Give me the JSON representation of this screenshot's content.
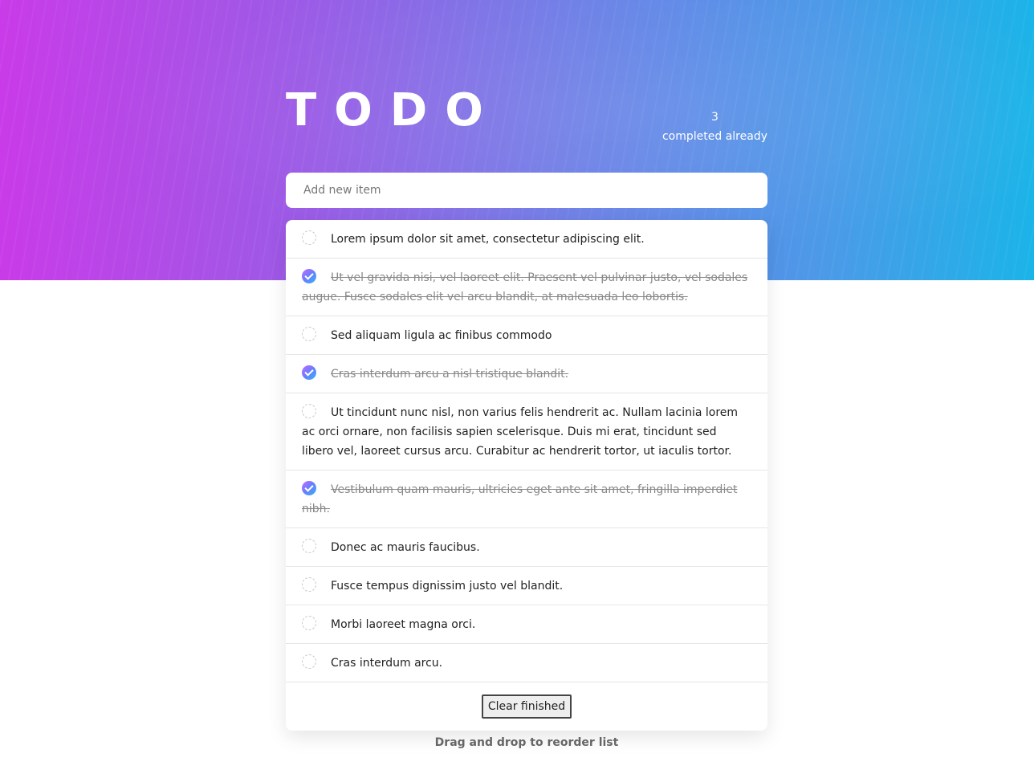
{
  "header": {
    "title": "TODO",
    "completed_count": "3",
    "completed_label": "completed already"
  },
  "add_item": {
    "placeholder": "Add new item",
    "value": ""
  },
  "todos": [
    {
      "text": "Lorem ipsum dolor sit amet, consectetur adipiscing elit.",
      "done": false
    },
    {
      "text": "Ut vel gravida nisi, vel laoreet elit. Praesent vel pulvinar justo, vel sodales augue. Fusce sodales elit vel arcu blandit, at malesuada leo lobortis.",
      "done": true
    },
    {
      "text": "Sed aliquam ligula ac finibus commodo",
      "done": false
    },
    {
      "text": "Cras interdum arcu a nisl tristique blandit.",
      "done": true
    },
    {
      "text": "Ut tincidunt nunc nisl, non varius felis hendrerit ac. Nullam lacinia lorem ac orci ornare, non facilisis sapien scelerisque. Duis mi erat, tincidunt sed libero vel, laoreet cursus arcu. Curabitur ac hendrerit tortor, ut iaculis tortor.",
      "done": false
    },
    {
      "text": "Vestibulum quam mauris, ultricies eget ante sit amet, fringilla imperdiet nibh.",
      "done": true
    },
    {
      "text": "Donec ac mauris faucibus.",
      "done": false
    },
    {
      "text": "Fusce tempus dignissim justo vel blandit.",
      "done": false
    },
    {
      "text": "Morbi laoreet magna orci.",
      "done": false
    },
    {
      "text": "Cras interdum arcu.",
      "done": false
    }
  ],
  "footer": {
    "clear_label": "Clear finished"
  },
  "hint": "Drag and drop to reorder list",
  "colors": {
    "gradient_start": "#c93be8",
    "gradient_end": "#1bb4e8",
    "check_done": "#6a7dff"
  }
}
